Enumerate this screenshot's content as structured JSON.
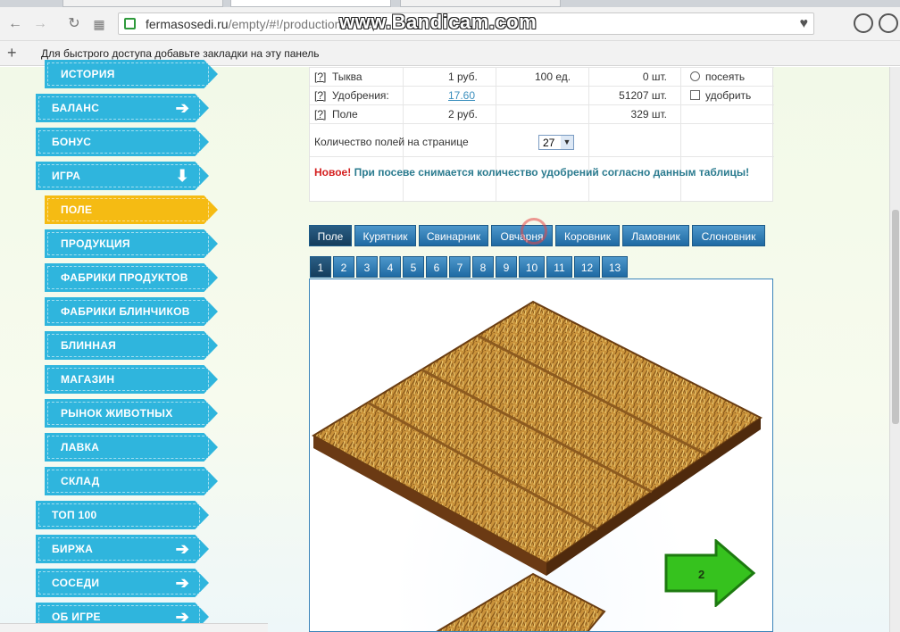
{
  "browser": {
    "url_host": "fermasosedi.ru",
    "url_path": "/empty/#!/production/sheep",
    "bookmarks_hint": "Для быстрого доступа добавьте закладки на эту панель",
    "watermark": "www.Bandicam.com"
  },
  "sidebar": {
    "items": [
      {
        "label": "ИСТОРИЯ",
        "level": "sub"
      },
      {
        "label": "БАЛАНС",
        "level": "main",
        "arrow": "right"
      },
      {
        "label": "БОНУС",
        "level": "main"
      },
      {
        "label": "ИГРА",
        "level": "main",
        "arrow": "down"
      },
      {
        "label": "ПОЛЕ",
        "level": "sub",
        "active": true
      },
      {
        "label": "ПРОДУКЦИЯ",
        "level": "sub"
      },
      {
        "label": "ФАБРИКИ ПРОДУКТОВ",
        "level": "sub"
      },
      {
        "label": "ФАБРИКИ БЛИНЧИКОВ",
        "level": "sub"
      },
      {
        "label": "БЛИННАЯ",
        "level": "sub"
      },
      {
        "label": "МАГАЗИН",
        "level": "sub"
      },
      {
        "label": "РЫНОК ЖИВОТНЫХ",
        "level": "sub"
      },
      {
        "label": "ЛАВКА",
        "level": "sub"
      },
      {
        "label": "СКЛАД",
        "level": "sub"
      },
      {
        "label": "ТОП 100",
        "level": "main"
      },
      {
        "label": "БИРЖА",
        "level": "main",
        "arrow": "right"
      },
      {
        "label": "СОСЕДИ",
        "level": "main",
        "arrow": "right"
      },
      {
        "label": "ОБ ИГРЕ",
        "level": "main",
        "arrow": "right"
      }
    ]
  },
  "table": {
    "rows": [
      {
        "help": "[?]",
        "name": "Тыква",
        "price": "1 руб.",
        "amount": "100 ед.",
        "stock": "0 шт.",
        "action": "посеять",
        "action_type": "radio"
      },
      {
        "help": "[?]",
        "name": "Удобрения:",
        "price": "17.60",
        "amount": "",
        "stock": "51207 шт.",
        "action": "удобрить",
        "action_type": "checkbox"
      },
      {
        "help": "[?]",
        "name": "Поле",
        "price": "2 руб.",
        "amount": "",
        "stock": "329 шт.",
        "action": "",
        "action_type": ""
      }
    ],
    "per_page_label": "Количество полей на странице",
    "per_page_value": "27",
    "notice_new": "Новое!",
    "notice_text": "При посеве снимается количество удобрений согласно данным таблицы!"
  },
  "tabs": [
    "Поле",
    "Курятник",
    "Свинарник",
    "Овчарня",
    "Коровник",
    "Ламовник",
    "Слоновник"
  ],
  "active_tab": "Поле",
  "pages": [
    "1",
    "2",
    "3",
    "4",
    "5",
    "6",
    "7",
    "8",
    "9",
    "10",
    "11",
    "12",
    "13"
  ],
  "active_page": "1",
  "next_button": "2"
}
